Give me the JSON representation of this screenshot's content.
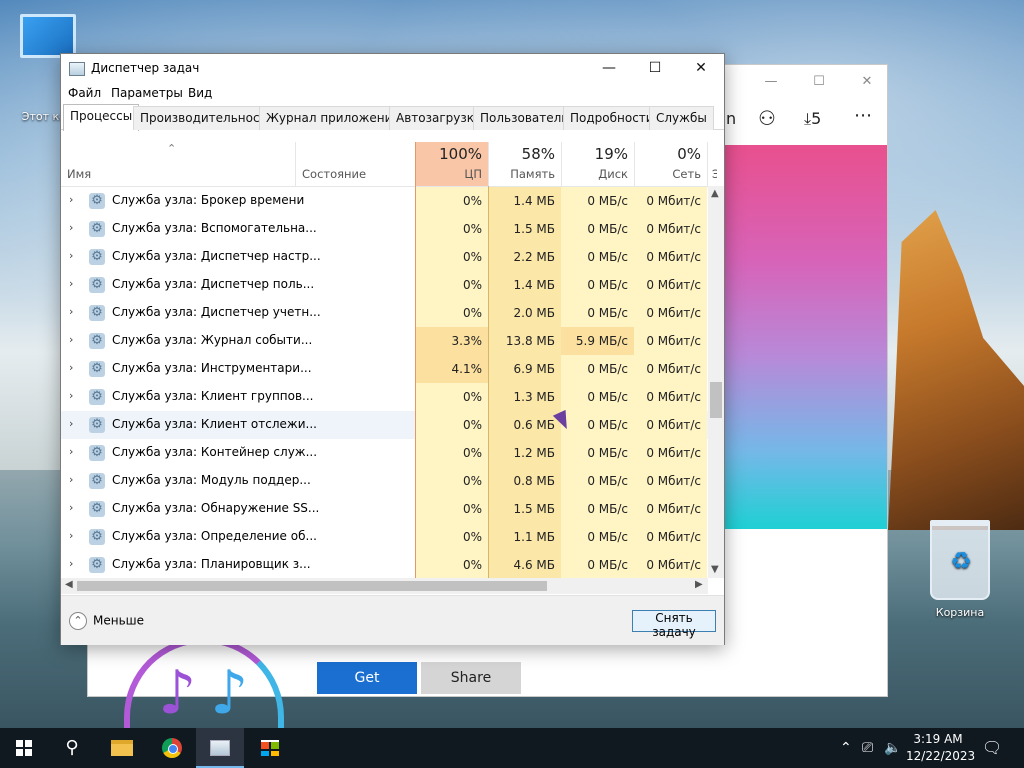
{
  "desktop": {
    "pc_label": "Этот ком",
    "bin_label": "Корзина"
  },
  "store": {
    "header_right": "n",
    "downloads_count": "5",
    "get_label": "Get",
    "share_label": "Share"
  },
  "taskmgr": {
    "title": "Диспетчер задач",
    "menu": [
      "Файл",
      "Параметры",
      "Вид"
    ],
    "tabs": [
      "Процессы",
      "Производительность",
      "Журнал приложений",
      "Автозагрузка",
      "Пользователи",
      "Подробности",
      "Службы"
    ],
    "columns": {
      "name": "Имя",
      "state": "Состояние",
      "cpu_pct": "100%",
      "cpu": "ЦП",
      "mem_pct": "58%",
      "mem": "Память",
      "disk_pct": "19%",
      "disk": "Диск",
      "net_pct": "0%",
      "net": "Сеть",
      "extra": "Э"
    },
    "rows": [
      {
        "name": "Служба узла: Брокер времени",
        "cpu": "0%",
        "mem": "1.4 МБ",
        "disk": "0 МБ/с",
        "net": "0 Мбит/с"
      },
      {
        "name": "Служба узла: Вспомогательна...",
        "cpu": "0%",
        "mem": "1.5 МБ",
        "disk": "0 МБ/с",
        "net": "0 Мбит/с"
      },
      {
        "name": "Служба узла: Диспетчер настр...",
        "cpu": "0%",
        "mem": "2.2 МБ",
        "disk": "0 МБ/с",
        "net": "0 Мбит/с"
      },
      {
        "name": "Служба узла: Диспетчер поль...",
        "cpu": "0%",
        "mem": "1.4 МБ",
        "disk": "0 МБ/с",
        "net": "0 Мбит/с"
      },
      {
        "name": "Служба узла: Диспетчер учетн...",
        "cpu": "0%",
        "mem": "2.0 МБ",
        "disk": "0 МБ/с",
        "net": "0 Мбит/с"
      },
      {
        "name": "Служба узла: Журнал событи...",
        "cpu": "3.3%",
        "mem": "13.8 МБ",
        "disk": "5.9 МБ/с",
        "net": "0 Мбит/с"
      },
      {
        "name": "Служба узла: Инструментари...",
        "cpu": "4.1%",
        "mem": "6.9 МБ",
        "disk": "0 МБ/с",
        "net": "0 Мбит/с"
      },
      {
        "name": "Служба узла: Клиент группов...",
        "cpu": "0%",
        "mem": "1.3 МБ",
        "disk": "0 МБ/с",
        "net": "0 Мбит/с"
      },
      {
        "name": "Служба узла: Клиент отслежи...",
        "cpu": "0%",
        "mem": "0.6 МБ",
        "disk": "0 МБ/с",
        "net": "0 Мбит/с"
      },
      {
        "name": "Служба узла: Контейнер служ...",
        "cpu": "0%",
        "mem": "1.2 МБ",
        "disk": "0 МБ/с",
        "net": "0 Мбит/с"
      },
      {
        "name": "Служба узла: Модуль поддер...",
        "cpu": "0%",
        "mem": "0.8 МБ",
        "disk": "0 МБ/с",
        "net": "0 Мбит/с"
      },
      {
        "name": "Служба узла: Обнаружение SS...",
        "cpu": "0%",
        "mem": "1.5 МБ",
        "disk": "0 МБ/с",
        "net": "0 Мбит/с"
      },
      {
        "name": "Служба узла: Определение об...",
        "cpu": "0%",
        "mem": "1.1 МБ",
        "disk": "0 МБ/с",
        "net": "0 Мбит/с"
      },
      {
        "name": "Служба узла: Планировщик з...",
        "cpu": "0%",
        "mem": "4.6 МБ",
        "disk": "0 МБ/с",
        "net": "0 Мбит/с"
      }
    ],
    "fewer_label": "Меньше",
    "end_task_label": "Снять задачу"
  },
  "taskbar": {
    "time": "3:19 AM",
    "date": "12/22/2023"
  },
  "colors": {
    "cpu_header": "#f9c7a8",
    "cell_light": "#fff4c4",
    "cell_mem": "#fbe7a8",
    "accent": "#1a6fd0"
  }
}
